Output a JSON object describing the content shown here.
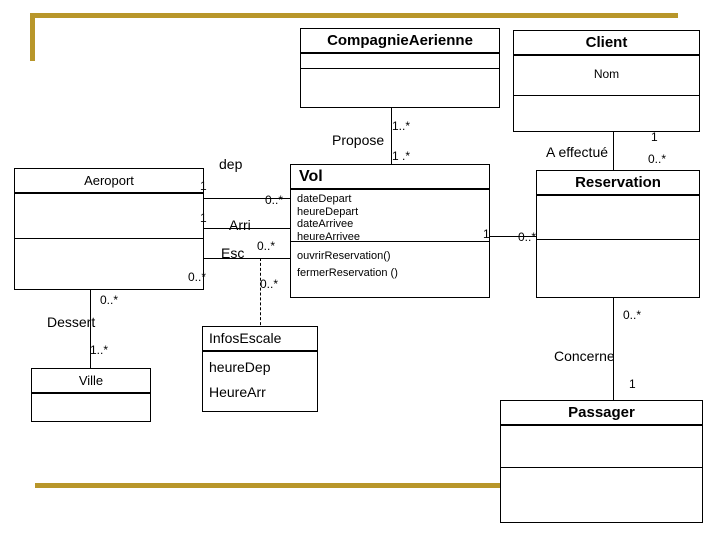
{
  "diagram": {
    "type": "uml-class-diagram",
    "accent_color": "#b8962a",
    "background_color": "#ffffff",
    "line_color": "#000000"
  },
  "classes": {
    "compagnie": {
      "name": "CompagnieAerienne",
      "attributes": [],
      "operations": []
    },
    "client": {
      "name": "Client",
      "attributes": [
        "Nom"
      ],
      "operations": []
    },
    "aeroport": {
      "name": "Aeroport",
      "attributes": [],
      "operations": []
    },
    "vol": {
      "name": "Vol",
      "attributes": [
        "dateDepart",
        "heureDepart",
        "dateArrivee",
        "heureArrivee"
      ],
      "operations": [
        "ouvrirReservation()",
        "fermerReservation ()"
      ]
    },
    "reservation": {
      "name": "Reservation",
      "attributes": [],
      "operations": []
    },
    "ville": {
      "name": "Ville",
      "attributes": [],
      "operations": []
    },
    "infos_escale": {
      "name": "InfosEscale",
      "attributes": [
        "heureDep",
        "HeureArr"
      ],
      "operations": []
    },
    "passager": {
      "name": "Passager",
      "attributes": [],
      "operations": []
    }
  },
  "associations": {
    "propose": {
      "name": "Propose",
      "source_multiplicity": "1..*",
      "target_multiplicity": "1 .*"
    },
    "a_effectue": {
      "name": "A effectué",
      "source_multiplicity": "1",
      "target_multiplicity": "0..*"
    },
    "dep": {
      "name": "dep",
      "source_multiplicity": "1",
      "target_multiplicity": "0..*"
    },
    "arri": {
      "name": "Arri",
      "source_multiplicity": "1",
      "target_multiplicity": "0..*"
    },
    "esc": {
      "name": "Esc",
      "source_multiplicity": "0..*",
      "target_multiplicity": "0..*"
    },
    "escale_infos": {
      "name": "",
      "source_multiplicity": "0..*"
    },
    "dessert": {
      "name": "Dessert",
      "source_multiplicity": "0..*",
      "target_multiplicity": "1..*"
    },
    "vol_reservation": {
      "name": "",
      "source_multiplicity": "1",
      "target_multiplicity": "0..*"
    },
    "concerne": {
      "name": "Concerne",
      "source_multiplicity": "0..*",
      "target_multiplicity": "1"
    }
  }
}
